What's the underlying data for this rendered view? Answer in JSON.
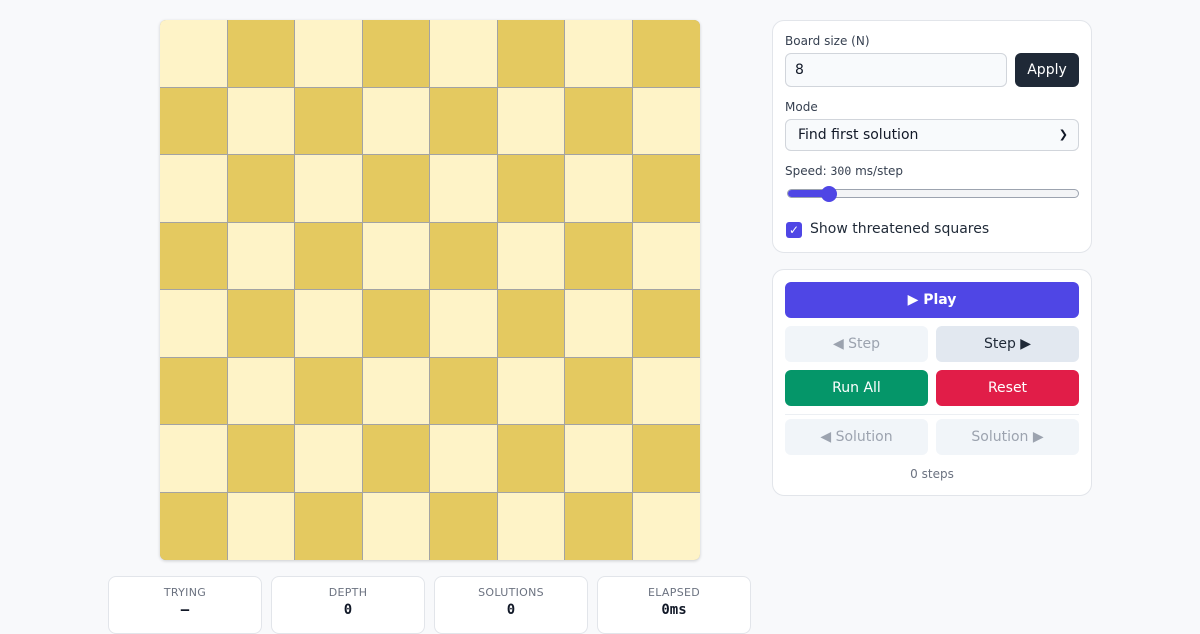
{
  "board": {
    "size": 8,
    "light_color": "#fef3c7",
    "dark_color": "#e4c960"
  },
  "stats": [
    {
      "label": "TRYING",
      "value": "—"
    },
    {
      "label": "DEPTH",
      "value": "0"
    },
    {
      "label": "SOLUTIONS",
      "value": "0"
    },
    {
      "label": "ELAPSED",
      "value": "0ms"
    }
  ],
  "settings": {
    "board_size_label": "Board size (N)",
    "board_size_value": "8",
    "apply_label": "Apply",
    "mode_label": "Mode",
    "mode_selected": "Find first solution",
    "speed_label": "Speed:",
    "speed_value": "300",
    "speed_unit": "ms/step",
    "speed_level_fraction": 0.14,
    "show_threatened_label": "Show threatened squares",
    "show_threatened_checked": true
  },
  "controls": {
    "play_label": "▶ Play",
    "step_back_label": "◀ Step",
    "step_forward_label": "Step ▶",
    "run_all_label": "Run All",
    "reset_label": "Reset",
    "prev_solution_label": "◀ Solution",
    "next_solution_label": "Solution ▶",
    "steps_text": "0 steps"
  },
  "colors": {
    "accent": "#4f46e5",
    "run": "#059669",
    "reset": "#e11d48",
    "dark_button": "#1f2937"
  }
}
